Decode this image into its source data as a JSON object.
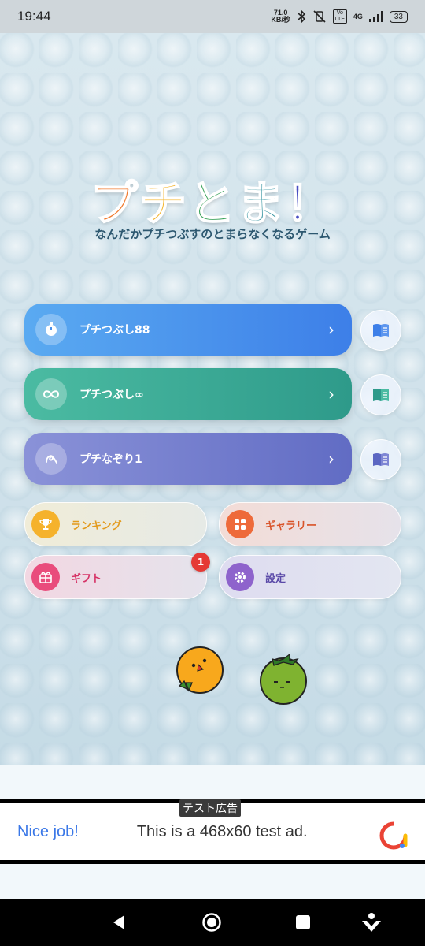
{
  "status": {
    "time": "19:44",
    "net_speed_top": "71.0",
    "net_speed_bottom": "KB/秒",
    "network": "4G",
    "volte": "Vo LTE",
    "battery": "33"
  },
  "logo": {
    "chars": [
      "プ",
      "チ",
      "と",
      "ま",
      "！"
    ],
    "colors": [
      "#f07a2e",
      "#f4b42a",
      "#3aa35a",
      "#2c8f9c",
      "#4a4fc2"
    ]
  },
  "tagline": "なんだかプチつぶすのとまらなくなるゲーム",
  "modes": [
    {
      "label": "プチつぶし88",
      "icon": "stopwatch-icon",
      "color_start": "#59aaf0",
      "color_end": "#3d7fe8"
    },
    {
      "label": "プチつぶし∞",
      "icon": "infinity-icon",
      "color_start": "#4bbba2",
      "color_end": "#2e9a8a"
    },
    {
      "label": "プチなぞり1",
      "icon": "trace-icon",
      "color_start": "#8a92d8",
      "color_end": "#616cc4"
    }
  ],
  "menu": {
    "ranking": "ランキング",
    "gallery": "ギャラリー",
    "gift": "ギフト",
    "settings": "設定",
    "gift_badge": "1"
  },
  "ad": {
    "tag": "テスト広告",
    "title": "Nice job!",
    "text": "This is a 468x60 test ad."
  }
}
